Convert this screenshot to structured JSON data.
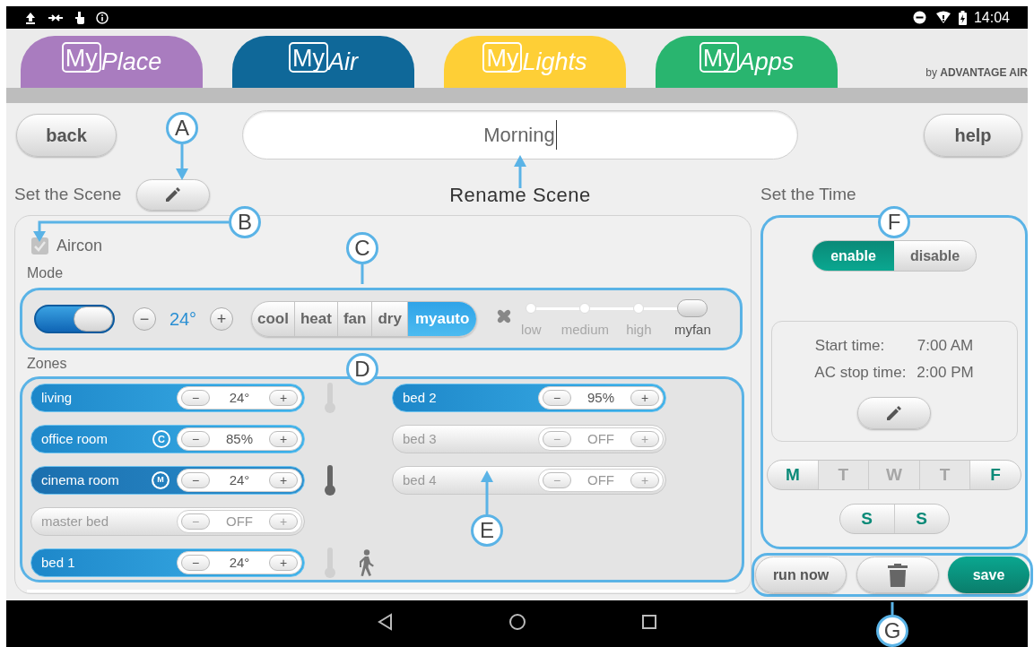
{
  "status_bar": {
    "time": "14:04"
  },
  "app_tabs": [
    {
      "prefix": "My",
      "name": "Place",
      "color": "#a97cbf"
    },
    {
      "prefix": "My",
      "name": "Air",
      "color": "#0f6899"
    },
    {
      "prefix": "My",
      "name": "Lights",
      "color": "#fecf36"
    },
    {
      "prefix": "My",
      "name": "Apps",
      "color": "#29b56f"
    }
  ],
  "brand": "by **ADVANTAGE AIR**",
  "header": {
    "back": "back",
    "scene_name": "Morning",
    "help": "help"
  },
  "set_scene_label": "Set the Scene",
  "rename_label": "Rename Scene",
  "set_time_label": "Set the Time",
  "aircon": {
    "label": "Aircon",
    "checked": true
  },
  "mode_label": "Mode",
  "ac_power": {
    "on": true
  },
  "temperature": {
    "minus": "−",
    "value": "24°",
    "plus": "+"
  },
  "modes": [
    {
      "label": "cool",
      "selected": false
    },
    {
      "label": "heat",
      "selected": false
    },
    {
      "label": "fan",
      "selected": false
    },
    {
      "label": "dry",
      "selected": false
    },
    {
      "label": "myauto",
      "selected": true
    }
  ],
  "fan_speeds": [
    {
      "label": "low",
      "selected": false
    },
    {
      "label": "medium",
      "selected": false
    },
    {
      "label": "high",
      "selected": false
    },
    {
      "label": "myfan",
      "selected": true
    }
  ],
  "zones_label": "Zones",
  "zone_columns": [
    [
      {
        "name": "living",
        "value": "24°",
        "on": true,
        "sensor": {
          "active": false
        }
      },
      {
        "name": "office room",
        "value": "85%",
        "on": true,
        "badge": {
          "kind": "circle",
          "letter": "C"
        }
      },
      {
        "name": "cinema room",
        "value": "24°",
        "on": true,
        "badge": {
          "kind": "target",
          "letter": "M"
        },
        "sensor": {
          "active": true
        }
      },
      {
        "name": "master bed",
        "value": "OFF",
        "on": false
      },
      {
        "name": "bed 1",
        "value": "24°",
        "on": true,
        "sensor": {
          "active": false
        },
        "motion": true
      }
    ],
    [
      {
        "name": "bed 2",
        "value": "95%",
        "on": true
      },
      {
        "name": "bed 3",
        "value": "OFF",
        "on": false
      },
      {
        "name": "bed 4",
        "value": "OFF",
        "on": false
      }
    ]
  ],
  "schedule": [
    {
      "label": "enable",
      "selected": true
    },
    {
      "label": "disable",
      "selected": false
    }
  ],
  "times": [
    {
      "label": "Start time:",
      "value": "7:00 AM"
    },
    {
      "label": "AC stop time:",
      "value": "2:00 PM"
    }
  ],
  "days": [
    [
      {
        "label": "M",
        "selected": true
      },
      {
        "label": "T",
        "selected": false
      },
      {
        "label": "W",
        "selected": false
      },
      {
        "label": "T",
        "selected": false
      },
      {
        "label": "F",
        "selected": true
      }
    ],
    [
      {
        "label": "S",
        "selected": true
      },
      {
        "label": "S",
        "selected": true
      }
    ]
  ],
  "actions": {
    "run_now": "run now",
    "save": "save"
  },
  "callouts": [
    "A",
    "B",
    "C",
    "D",
    "E",
    "F",
    "G"
  ]
}
